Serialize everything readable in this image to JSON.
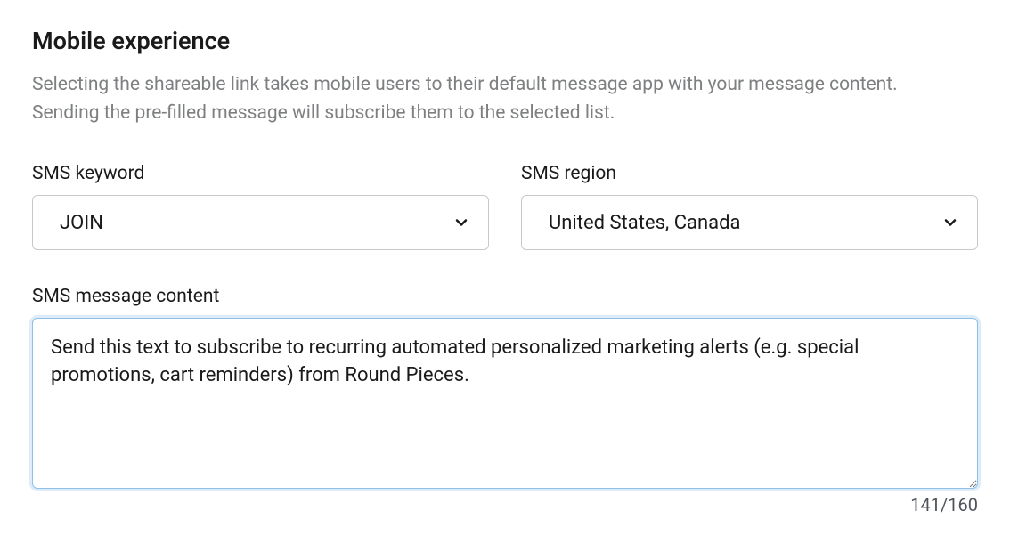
{
  "section": {
    "title": "Mobile experience",
    "description": "Selecting the shareable link takes mobile users to their default message app with your message content. Sending the pre-filled message will subscribe them to the selected list."
  },
  "smsKeyword": {
    "label": "SMS keyword",
    "value": "JOIN"
  },
  "smsRegion": {
    "label": "SMS region",
    "value": "United States, Canada"
  },
  "smsMessageContent": {
    "label": "SMS message content",
    "value": "Send this text to subscribe to recurring automated personalized marketing alerts (e.g. special promotions, cart reminders) from Round Pieces.",
    "charCount": "141/160"
  }
}
